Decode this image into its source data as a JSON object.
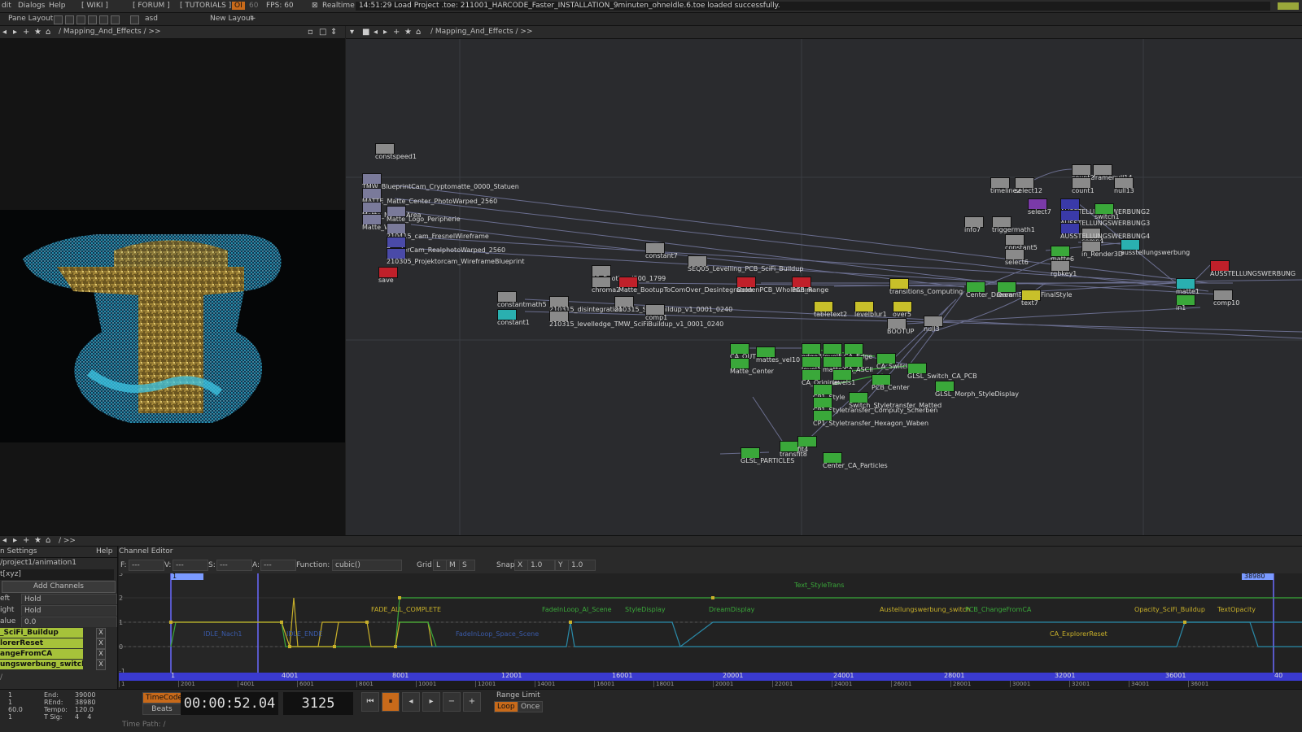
{
  "menubar": {
    "items": [
      "dit",
      "Dialogs",
      "Help",
      "[ WIKI ]",
      "[ FORUM ]",
      "[ TUTORIALS ]"
    ],
    "oi_badge": "OI",
    "fps_small": "60",
    "fps_label": "FPS: 60",
    "realtime_check": "⊠",
    "realtime_label": "Realtime",
    "status": "14:51:29 Load Project .toe: 211001_HARCODE_Faster_INSTALLATION_9minuten_ohneIdle.6.toe loaded successfully."
  },
  "layoutbar": {
    "pane_layout": "Pane Layout",
    "layout_name": "asd",
    "new_layout": "New Layout",
    "plus": "+"
  },
  "left_pane": {
    "path": "/ Mapping_And_Effects / >>"
  },
  "network": {
    "path": "/ Mapping_And_Effects / >>",
    "ops": [
      {
        "label": "constspeed1",
        "color": "#8a8a8a",
        "x": 36,
        "y": 128
      },
      {
        "label": "TMW_BlueprintCam_Cryptomatte_0000_Statuen",
        "color": "#7a7a9a",
        "x": 20,
        "y": 165
      },
      {
        "label": "MATTE_Matte_Center_PhotoWarped_2560",
        "color": "#7a7a9a",
        "x": 20,
        "y": 183
      },
      {
        "label": "Matte_MotionArea",
        "color": "#7a7a9a",
        "x": 20,
        "y": 200
      },
      {
        "label": "Matte_Logo_Peripherie",
        "color": "#7a7a9a",
        "x": 50,
        "y": 205
      },
      {
        "label": "Matte_Whole",
        "color": "#7a7a9a",
        "x": 20,
        "y": 215
      },
      {
        "label": "210415_cam_FresnelWireframe",
        "color": "#7a7a9a",
        "x": 50,
        "y": 226
      },
      {
        "label": "RenderCam_RealphotoWarped_2560",
        "color": "#4a4aa8",
        "x": 50,
        "y": 243
      },
      {
        "label": "210305_Projektorcam_WireframeBlueprint",
        "color": "#4a4aa8",
        "x": 50,
        "y": 257
      },
      {
        "label": "save",
        "color": "#c0202a",
        "x": 40,
        "y": 280
      },
      {
        "label": "constant7",
        "color": "#8a8a8a",
        "x": 368,
        "y": 250
      },
      {
        "label": "SEQ05_Levelling_PCB_SciFi_Buildup",
        "color": "#8a8a8a",
        "x": 420,
        "y": 266
      },
      {
        "label": "02_Bootlevel200_1799",
        "color": "#8a8a8a",
        "x": 302,
        "y": 278
      },
      {
        "label": "chroma2",
        "color": "#8a8a8a",
        "x": 302,
        "y": 292
      },
      {
        "label": "Matte_BootupToComOver_Desintegration",
        "color": "#c0202a",
        "x": 335,
        "y": 292
      },
      {
        "label": "GoldenPCB_WholeAnim",
        "color": "#c0202a",
        "x": 480,
        "y": 292
      },
      {
        "label": "PCB_Range",
        "color": "#c0202a",
        "x": 548,
        "y": 292
      },
      {
        "label": "constantmath5",
        "color": "#8a8a8a",
        "x": 186,
        "y": 310
      },
      {
        "label": "constant1",
        "color": "#2ab0b0",
        "x": 186,
        "y": 332
      },
      {
        "label": "210315_disintegration",
        "color": "#8a8a8a",
        "x": 250,
        "y": 316
      },
      {
        "label": "210315_SciFiBuildup_v1_0001_0240",
        "color": "#8a8a8a",
        "x": 330,
        "y": 316
      },
      {
        "label": "comp1",
        "color": "#8a8a8a",
        "x": 368,
        "y": 326
      },
      {
        "label": "210315_levelledge_TMW_SciFiBuildup_v1_0001_0240",
        "color": "#8a8a8a",
        "x": 250,
        "y": 334
      },
      {
        "label": "transitions_Computing",
        "color": "#c8c02a",
        "x": 668,
        "y": 294
      },
      {
        "label": "tabletext2",
        "color": "#c8c02a",
        "x": 575,
        "y": 322
      },
      {
        "label": "levelblur1",
        "color": "#c8c02a",
        "x": 625,
        "y": 322
      },
      {
        "label": "over5",
        "color": "#c8c02a",
        "x": 672,
        "y": 322
      },
      {
        "label": "BOOTUP",
        "color": "#8a8a8a",
        "x": 665,
        "y": 343
      },
      {
        "label": "null3",
        "color": "#8a8a8a",
        "x": 710,
        "y": 340
      },
      {
        "label": "Center_Dream",
        "color": "#3aa83a",
        "x": 762,
        "y": 298
      },
      {
        "label": "DreamEffect_FinalStyle",
        "color": "#3aa83a",
        "x": 800,
        "y": 298
      },
      {
        "label": "text7",
        "color": "#c8c02a",
        "x": 830,
        "y": 308
      },
      {
        "label": "CA_OUT",
        "color": "#3aa83a",
        "x": 472,
        "y": 374
      },
      {
        "label": "mattes_vel10",
        "color": "#3aa83a",
        "x": 504,
        "y": 378
      },
      {
        "label": "edge3",
        "color": "#3aa83a",
        "x": 560,
        "y": 374
      },
      {
        "label": "level5",
        "color": "#3aa83a",
        "x": 586,
        "y": 374
      },
      {
        "label": "CA_Edge",
        "color": "#3aa83a",
        "x": 612,
        "y": 374
      },
      {
        "label": "Matte_Center",
        "color": "#3aa83a",
        "x": 472,
        "y": 392
      },
      {
        "label": "CA_Switcher",
        "color": "#3aa83a",
        "x": 652,
        "y": 386
      },
      {
        "label": "level1",
        "color": "#3aa83a",
        "x": 560,
        "y": 390
      },
      {
        "label": "matte2",
        "color": "#3aa83a",
        "x": 586,
        "y": 390
      },
      {
        "label": "CA_ASCII",
        "color": "#3aa83a",
        "x": 612,
        "y": 390
      },
      {
        "label": "CA_Original",
        "color": "#3aa83a",
        "x": 560,
        "y": 406
      },
      {
        "label": "levels1",
        "color": "#3aa83a",
        "x": 598,
        "y": 406
      },
      {
        "label": "PCB_Center",
        "color": "#3aa83a",
        "x": 646,
        "y": 412
      },
      {
        "label": "GLSL_Switch_CA_PCB",
        "color": "#3aa83a",
        "x": 690,
        "y": 398
      },
      {
        "label": "GLSL_Morph_StyleDisplay",
        "color": "#3aa83a",
        "x": 724,
        "y": 420
      },
      {
        "label": "CP1_Style",
        "color": "#3aa83a",
        "x": 574,
        "y": 424
      },
      {
        "label": "CP1_Styletransfer_Computy_Scherben",
        "color": "#3aa83a",
        "x": 574,
        "y": 440
      },
      {
        "label": "Switch_Styletransfer_Matted",
        "color": "#3aa83a",
        "x": 618,
        "y": 434
      },
      {
        "label": "CP1_Styletransfer_Hexagon_Waben",
        "color": "#3aa83a",
        "x": 574,
        "y": 456
      },
      {
        "label": "GLSL_PARTICLES",
        "color": "#3aa83a",
        "x": 485,
        "y": 502
      },
      {
        "label": "transfit8",
        "color": "#3aa83a",
        "x": 533,
        "y": 494
      },
      {
        "label": "fit4",
        "color": "#3aa83a",
        "x": 555,
        "y": 488
      },
      {
        "label": "Center_CA_Particles",
        "color": "#3aa83a",
        "x": 586,
        "y": 508
      },
      {
        "label": "timeline2",
        "color": "#8a8a8a",
        "x": 792,
        "y": 170
      },
      {
        "label": "select12",
        "color": "#8a8a8a",
        "x": 822,
        "y": 170
      },
      {
        "label": "count2",
        "color": "#8a8a8a",
        "x": 892,
        "y": 154
      },
      {
        "label": "framenull14",
        "color": "#8a8a8a",
        "x": 918,
        "y": 154
      },
      {
        "label": "count1",
        "color": "#8a8a8a",
        "x": 892,
        "y": 170
      },
      {
        "label": "null13",
        "color": "#8a8a8a",
        "x": 944,
        "y": 170
      },
      {
        "label": "select7",
        "color": "#7a3aa8",
        "x": 838,
        "y": 196
      },
      {
        "label": "AUSSTELLUNGSWERBUNG2",
        "color": "#3a3aa8",
        "x": 878,
        "y": 196
      },
      {
        "label": "switch1",
        "color": "#3aa83a",
        "x": 920,
        "y": 202
      },
      {
        "label": "info7",
        "color": "#8a8a8a",
        "x": 760,
        "y": 218
      },
      {
        "label": "triggermath1",
        "color": "#8a8a8a",
        "x": 794,
        "y": 218
      },
      {
        "label": "AUSSTELLUNGSWERBUNG3",
        "color": "#3a3aa8",
        "x": 878,
        "y": 210
      },
      {
        "label": "comp4",
        "color": "#8a8a8a",
        "x": 904,
        "y": 232
      },
      {
        "label": "AUSSTELLUNGSWERBUNG4",
        "color": "#3a3aa8",
        "x": 878,
        "y": 226
      },
      {
        "label": "constant5",
        "color": "#8a8a8a",
        "x": 810,
        "y": 240
      },
      {
        "label": "ausstellungswerbung",
        "color": "#2ab0b0",
        "x": 952,
        "y": 246
      },
      {
        "label": "select6",
        "color": "#8a8a8a",
        "x": 810,
        "y": 258
      },
      {
        "label": "matte6",
        "color": "#3aa83a",
        "x": 866,
        "y": 254
      },
      {
        "label": "in_Render3D",
        "color": "#8a8a8a",
        "x": 904,
        "y": 248
      },
      {
        "label": "rgbkey1",
        "color": "#8a8a8a",
        "x": 866,
        "y": 272
      },
      {
        "label": "AUSSTELLUNGSWERBUNG",
        "color": "#c0202a",
        "x": 1062,
        "y": 272
      },
      {
        "label": "matte1",
        "color": "#2ab0b0",
        "x": 1020,
        "y": 294
      },
      {
        "label": "in1",
        "color": "#3aa83a",
        "x": 1020,
        "y": 314
      },
      {
        "label": "comp10",
        "color": "#8a8a8a",
        "x": 1066,
        "y": 308
      }
    ]
  },
  "anim_panel": {
    "header": "n Settings",
    "help": "Help",
    "path": "/project1/animation1",
    "xyz": "t[xyz]",
    "add_channels": "Add Channels",
    "left_label": "eft",
    "left_value": "Hold",
    "right_label": "ight",
    "right_value": "Hold",
    "value_label": "alue",
    "value_value": "0.0",
    "channels": [
      "_SciFi_Buildup",
      "lorerReset",
      "angeFromCA",
      "ungswerbung_switch"
    ],
    "slash": "/"
  },
  "channel_editor": {
    "title": "Channel Editor",
    "f_label": "F:",
    "f_value": "---",
    "v_label": "V:",
    "v_value": "---",
    "s_label": "S:",
    "s_value": "---",
    "a_label": "A:",
    "a_value": "---",
    "function_label": "Function:",
    "function_value": "cubic()",
    "grid_label": "Grid",
    "grid_l": "L",
    "grid_m": "M",
    "grid_s": "S",
    "snap_label": "Snap",
    "snap_x": "X",
    "snap_x_value": "1.0",
    "snap_y": "Y",
    "snap_y_value": "1.0",
    "y_ticks": [
      "3",
      "2",
      "1",
      "0",
      "-1"
    ],
    "range_start": "1",
    "range_end": "38980",
    "curve_labels": [
      "Text_StyleTrans",
      "FADE_ALL_COMPLETE",
      "FadeInLoop_AI_Scene",
      "StyleDisplay",
      "DreamDisplay",
      "Austellungswerbung_switch",
      "PCB_ChangeFromCA",
      "Opacity_SciFi_Buildup",
      "TextOpacity",
      "IDLE_Nach1",
      "IDLE_ENDE",
      "FadeInLoop_Space_Scene",
      "CA_ExplorerReset"
    ],
    "timebar_ticks": [
      "1",
      "4001",
      "8001",
      "12001",
      "16001",
      "20001",
      "24001",
      "28001",
      "32001",
      "36001",
      "40"
    ],
    "ruler_ticks": [
      "1",
      "2001",
      "4001",
      "6001",
      "8001",
      "10001",
      "12001",
      "14001",
      "16001",
      "18001",
      "20001",
      "22001",
      "24001",
      "26001",
      "28001",
      "30001",
      "32001",
      "34001",
      "36001"
    ]
  },
  "transport": {
    "left_col1": [
      "1",
      "1",
      "60.0",
      "1"
    ],
    "left_col2": [
      "End:",
      "REnd:",
      "Tempo:",
      "T Sig:"
    ],
    "left_col3": [
      "39000",
      "38980",
      "120.0",
      "4    4"
    ],
    "timecode_btn": "TimeCode",
    "beats_btn": "Beats",
    "timecode": "00:00:52.04",
    "frame": "3125",
    "range_limit": "Range Limit",
    "loop": "Loop",
    "once": "Once",
    "time_path": "Time Path: /"
  },
  "colors": {
    "accent_orange": "#c86a1a",
    "timebar": "#3a3ad0",
    "channel_green": "#a6c23a"
  }
}
